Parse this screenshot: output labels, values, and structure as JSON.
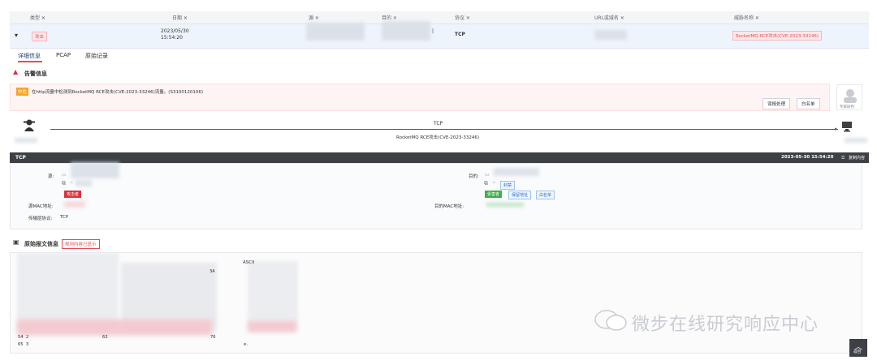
{
  "table": {
    "columns": [
      "类型 ✕",
      "日期 ✕",
      "源 ✕",
      "目的 ✕",
      "协议 ✕",
      "URL或域名 ✕",
      "威胁名称 ✕"
    ],
    "row": {
      "type": "攻击",
      "date_line1": "2023/05/30",
      "date_line2": "15:54:20",
      "protocol": "TCP",
      "threat_name": "RocketMQ RCE攻击(CVE-2023-33246)"
    }
  },
  "tabs": [
    "详细信息",
    "PCAP",
    "原始记录"
  ],
  "alert": {
    "title": "告警信息",
    "badge": "中危",
    "message": "在http流量中检测到RocketMQ RCE攻击(CVE-2023-33246)流量。(S3100120106)",
    "btn_handle": "误报处理",
    "btn_whitelist": "白名单",
    "expert_label": "专家研判"
  },
  "flow": {
    "protocol": "TCP",
    "threat": "RocketMQ RCE攻击(CVE-2023-33246)"
  },
  "detail": {
    "bar_title": "TCP",
    "bar_time": "2023-05-30 15:54:20",
    "bar_copy": "复制内容",
    "src_label": "源:",
    "dst_label": "目的:",
    "attacker_tag": "攻击者",
    "victim_tag": "受害者",
    "blocked_tag": "封禁",
    "protect_tag": "保留地址",
    "whitelist_tag": "白名单",
    "src_mac_label": "源MAC地址:",
    "dst_mac_label": "目的MAC地址:",
    "transport_label": "传输层协议:",
    "transport_value": "TCP"
  },
  "raw": {
    "title": "原始报文信息",
    "tag": "规则内容已显示",
    "ascii_label": "ASCII",
    "col_3a": "3A",
    "row1_a": "54 2",
    "row1_b": "63",
    "row1_c": "76",
    "row2_a": "65 3",
    "row2_b": "e."
  },
  "watermark": "微步在线研究响应中心",
  "back_top": "返回",
  "colors": {
    "accent": "#1f6fd6",
    "danger": "#d6333f",
    "success": "#3fae48",
    "dark": "#3d4045"
  }
}
